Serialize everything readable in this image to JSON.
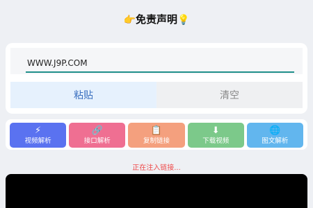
{
  "header": {
    "left_emoji": "👉",
    "title": "免责声明",
    "right_emoji": "💡"
  },
  "input": {
    "value": "WWW.J9P.COM"
  },
  "actions": {
    "paste_label": "粘贴",
    "clear_label": "清空"
  },
  "tools": [
    {
      "label": "视频解析",
      "icon": "lightning-icon",
      "glyph": "⚡",
      "color": "#5a72f0"
    },
    {
      "label": "接口解析",
      "icon": "link-icon",
      "glyph": "🔗",
      "color": "#ef6f92"
    },
    {
      "label": "复制链接",
      "icon": "clipboard-icon",
      "glyph": "📋",
      "color": "#f4a07e"
    },
    {
      "label": "下载视频",
      "icon": "download-icon",
      "glyph": "⬇",
      "color": "#7cc98a"
    },
    {
      "label": "图文解析",
      "icon": "globe-icon",
      "glyph": "🌐",
      "color": "#62b6ee"
    }
  ],
  "status": {
    "text": "正在注入链接...",
    "color": "#ef4b4b"
  },
  "theme": {
    "accent": "#1f8f8a",
    "paste_bg": "#e6f1fd",
    "paste_text": "#3a6fbf"
  }
}
